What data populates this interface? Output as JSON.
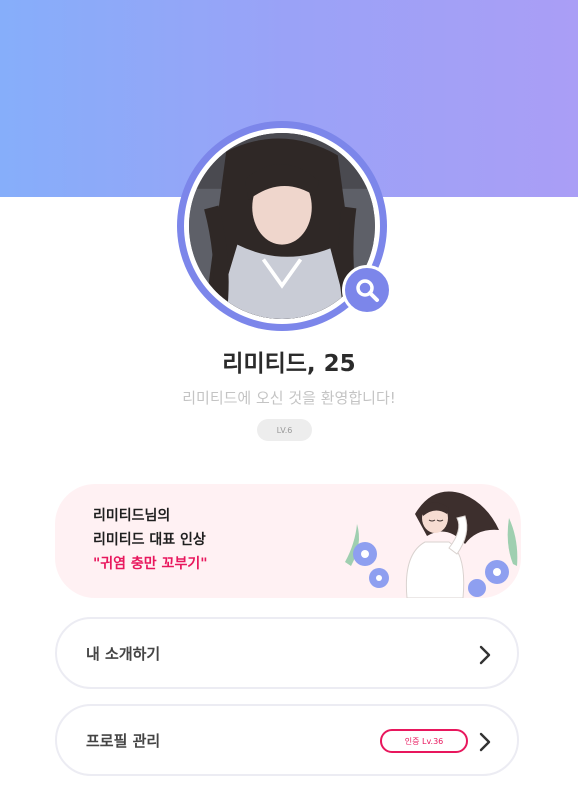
{
  "profile": {
    "name": "리미티드, 25",
    "welcome": "리미티드에 오신 것을 환영합니다!",
    "level": "LV.6"
  },
  "impression": {
    "line1": "리미티드님의",
    "line2": "리미티드 대표 인상",
    "quote": "\"귀염 충만 꼬부기\""
  },
  "menu": {
    "intro_label": "내 소개하기",
    "profile_label": "프로필 관리",
    "cert_badge": "인증 Lv.36"
  },
  "icons": {
    "search": "search-icon",
    "chevron": "chevron-right-icon"
  },
  "colors": {
    "header_gradient_start": "#86aefa",
    "header_gradient_end": "#aa9ef6",
    "accent_purple": "#7c86ea",
    "highlight_pink": "#e8175d",
    "card_background": "#fff1f3"
  }
}
